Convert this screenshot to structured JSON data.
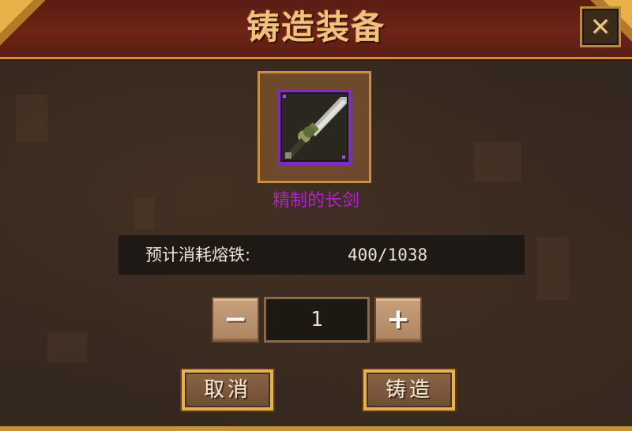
{
  "dialog": {
    "title": "铸造装备",
    "close_icon": "close-x-icon"
  },
  "item": {
    "icon": "long-sword-icon",
    "name": "精制的长剑",
    "rarity_color": "#b321c9"
  },
  "cost": {
    "label": "预计消耗熔铁:",
    "value": "400/1038"
  },
  "quantity": {
    "minus_label": "−",
    "value": "1",
    "plus_label": "+"
  },
  "actions": {
    "cancel_label": "取消",
    "forge_label": "铸造"
  },
  "colors": {
    "header": "#6e2416",
    "gold_trim": "#c9932f",
    "purple_frame": "#7c2bc9",
    "panel": "#35281f"
  }
}
